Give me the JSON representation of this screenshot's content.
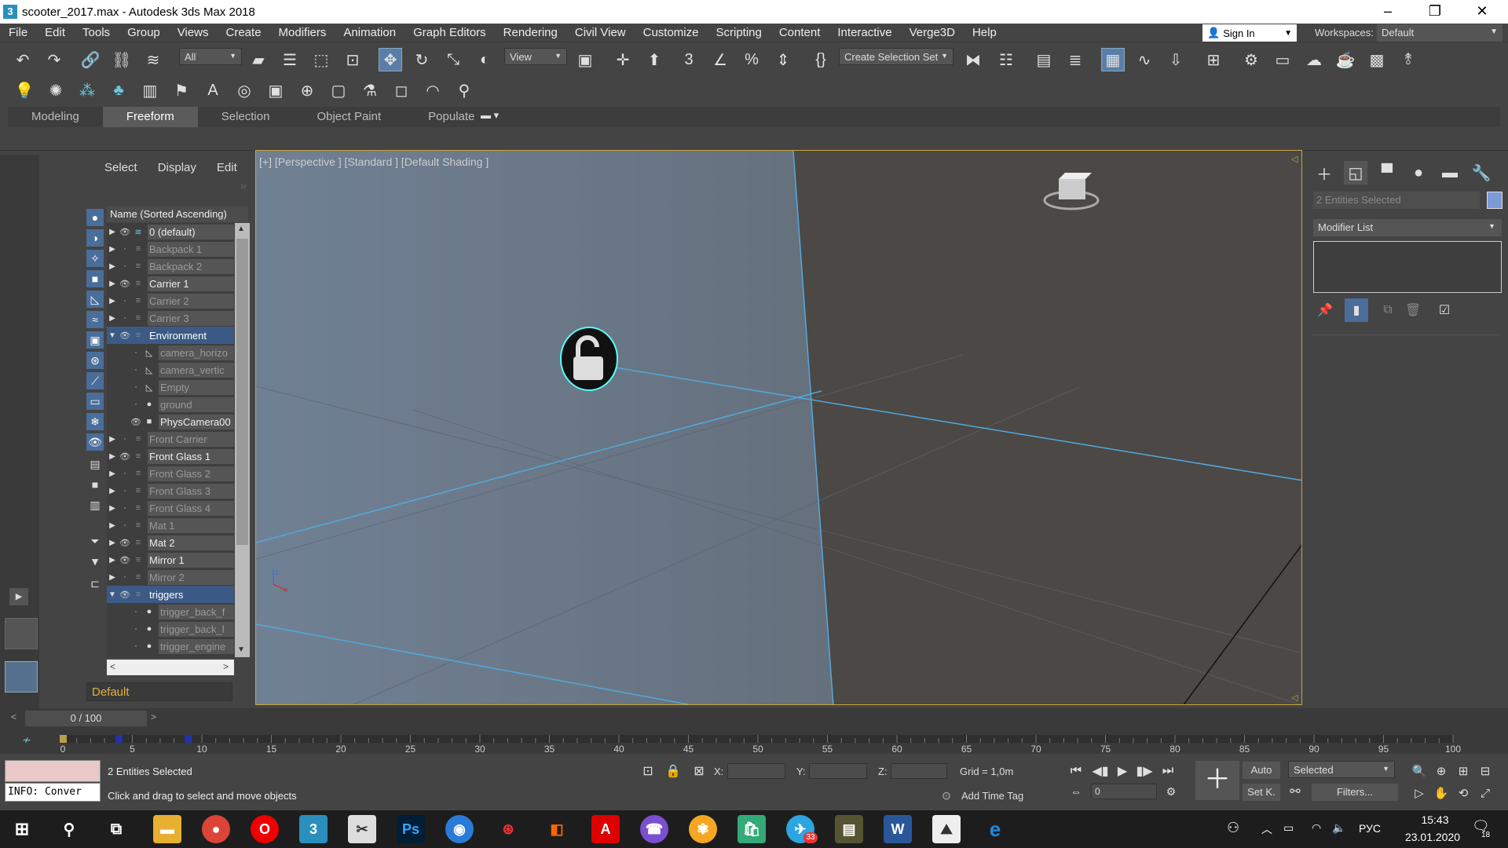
{
  "window": {
    "title": "scooter_2017.max - Autodesk 3ds Max 2018",
    "app_icon": "3"
  },
  "menu": [
    "File",
    "Edit",
    "Tools",
    "Group",
    "Views",
    "Create",
    "Modifiers",
    "Animation",
    "Graph Editors",
    "Rendering",
    "Civil View",
    "Customize",
    "Scripting",
    "Content",
    "Interactive",
    "Verge3D",
    "Help"
  ],
  "account": {
    "sign_in": "Sign In",
    "workspaces_label": "Workspaces:",
    "workspace": "Default"
  },
  "toolbar": {
    "selection_filter": "All",
    "ref_coord": "View",
    "named_selection": "Create Selection Set"
  },
  "ribbon": {
    "tabs": [
      "Modeling",
      "Freeform",
      "Selection",
      "Object Paint",
      "Populate"
    ],
    "active": "Freeform"
  },
  "scene_explorer": {
    "menu": [
      "Select",
      "Display",
      "Edit"
    ],
    "column_header": "Name (Sorted Ascending)",
    "rows": [
      {
        "name": "0 (default)",
        "level": 0,
        "arrow": "▶",
        "eye": true,
        "active": true
      },
      {
        "name": "Backpack 1",
        "level": 0,
        "arrow": "▶",
        "eye": false
      },
      {
        "name": "Backpack 2",
        "level": 0,
        "arrow": "▶",
        "eye": false
      },
      {
        "name": "Carrier 1",
        "level": 0,
        "arrow": "▶",
        "eye": true
      },
      {
        "name": "Carrier 2",
        "level": 0,
        "arrow": "▶",
        "eye": false
      },
      {
        "name": "Carrier 3",
        "level": 0,
        "arrow": "▶",
        "eye": false
      },
      {
        "name": "Environment",
        "level": 0,
        "arrow": "▼",
        "eye": true,
        "selected": true
      },
      {
        "name": "camera_horizo",
        "level": 1,
        "arrow": "",
        "eye": false,
        "icon": "◺"
      },
      {
        "name": "camera_vertic",
        "level": 1,
        "arrow": "",
        "eye": false,
        "icon": "◺"
      },
      {
        "name": "Empty",
        "level": 1,
        "arrow": "",
        "eye": false,
        "icon": "◺"
      },
      {
        "name": "ground",
        "level": 1,
        "arrow": "",
        "eye": false,
        "icon": "●"
      },
      {
        "name": "PhysCamera00",
        "level": 1,
        "arrow": "",
        "eye": true,
        "icon": "■"
      },
      {
        "name": "Front Carrier",
        "level": 0,
        "arrow": "▶",
        "eye": false
      },
      {
        "name": "Front Glass 1",
        "level": 0,
        "arrow": "▶",
        "eye": true
      },
      {
        "name": "Front Glass 2",
        "level": 0,
        "arrow": "▶",
        "eye": false
      },
      {
        "name": "Front Glass 3",
        "level": 0,
        "arrow": "▶",
        "eye": false
      },
      {
        "name": "Front Glass 4",
        "level": 0,
        "arrow": "▶",
        "eye": false
      },
      {
        "name": "Mat 1",
        "level": 0,
        "arrow": "▶",
        "eye": false
      },
      {
        "name": "Mat 2",
        "level": 0,
        "arrow": "▶",
        "eye": true
      },
      {
        "name": "Mirror 1",
        "level": 0,
        "arrow": "▶",
        "eye": true
      },
      {
        "name": "Mirror 2",
        "level": 0,
        "arrow": "▶",
        "eye": false
      },
      {
        "name": "triggers",
        "level": 0,
        "arrow": "▼",
        "eye": true,
        "selected": true
      },
      {
        "name": "trigger_back_f",
        "level": 1,
        "arrow": "",
        "eye": false,
        "icon": "●"
      },
      {
        "name": "trigger_back_l",
        "level": 1,
        "arrow": "",
        "eye": false,
        "icon": "●"
      },
      {
        "name": "trigger_engine",
        "level": 1,
        "arrow": "",
        "eye": false,
        "icon": "●"
      }
    ],
    "layer": "Default"
  },
  "viewport": {
    "label": "[+] [Perspective ] [Standard ] [Default Shading ]"
  },
  "command_panel": {
    "selection_name": "2 Entities Selected",
    "modifier_list": "Modifier List",
    "object_color": "#7b9ad6"
  },
  "time": {
    "slider": "0 / 100",
    "ticks": [
      "0",
      "5",
      "10",
      "15",
      "20",
      "25",
      "30",
      "35",
      "40",
      "45",
      "50",
      "55",
      "60",
      "65",
      "70",
      "75",
      "80",
      "85",
      "90",
      "95",
      "100"
    ]
  },
  "status": {
    "selection": "2 Entities Selected",
    "prompt": "Click and drag to select and move objects",
    "maxscript": "INFO: Conver",
    "x_label": "X:",
    "y_label": "Y:",
    "z_label": "Z:",
    "grid": "Grid = 1,0m",
    "add_time_tag": "Add Time Tag",
    "auto_key": "Auto",
    "set_key": "Set K.",
    "key_filter": "Selected",
    "filters": "Filters...",
    "frame": "0"
  },
  "taskbar": {
    "lang": "РУС",
    "time": "15:43",
    "date": "23.01.2020",
    "notif_count": "18",
    "badge": "33"
  }
}
